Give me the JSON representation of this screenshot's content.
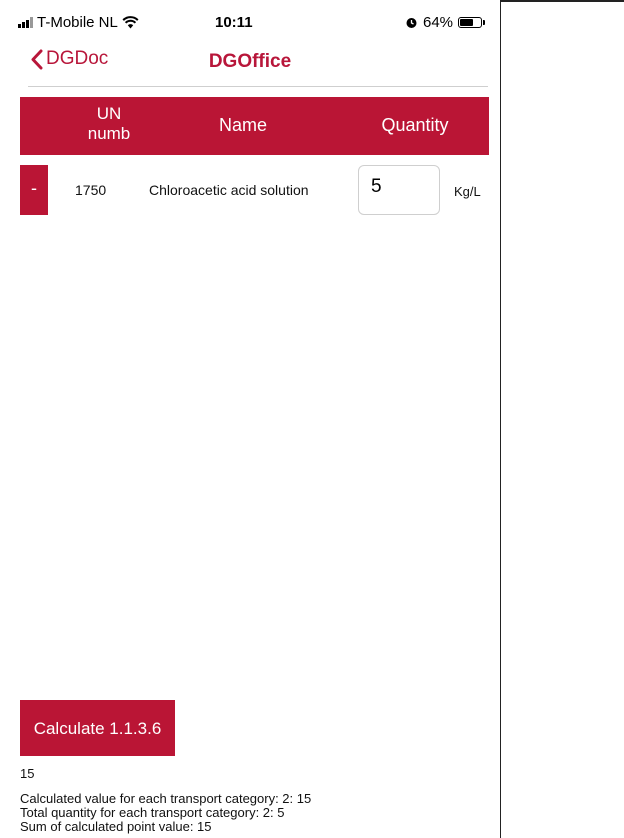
{
  "status_bar": {
    "carrier": "T-Mobile NL",
    "time": "10:11",
    "battery_percent": "64%",
    "battery_level": 0.64,
    "wifi_icon": "wifi-icon",
    "alarm_icon": "alarm-icon"
  },
  "nav": {
    "back_label": "DGDoc",
    "title": "DGOffice"
  },
  "table": {
    "headers": {
      "un_line1": "UN",
      "un_line2": "numb",
      "name": "Name",
      "quantity": "Quantity"
    },
    "rows": [
      {
        "remove_label": "-",
        "un_number": "1750",
        "name": "Chloroacetic acid solution",
        "quantity": "5",
        "unit": "Kg/L"
      }
    ]
  },
  "calculate_label": "Calculate 1.1.3.6",
  "results": {
    "value": "15",
    "lines": [
      "Calculated value for each transport category: 2: 15",
      "Total quantity for each transport category: 2: 5",
      "Sum of calculated point value: 15"
    ]
  },
  "colors": {
    "accent": "#ba1535",
    "nav_text": "#b8163a"
  }
}
